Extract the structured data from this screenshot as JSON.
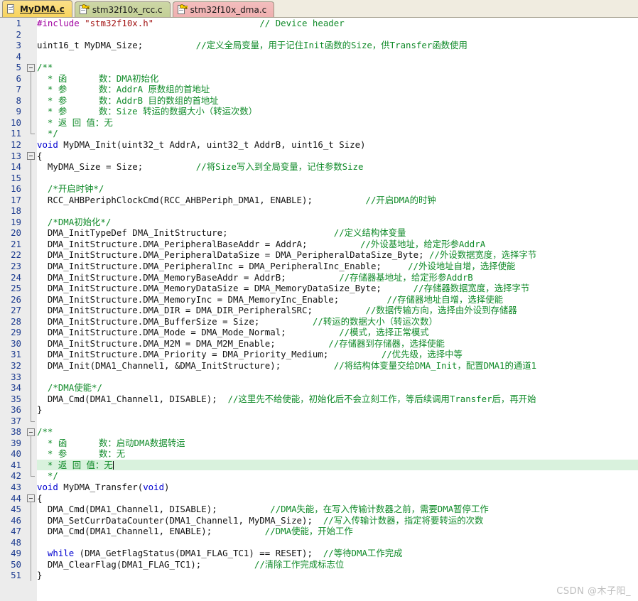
{
  "window": {
    "app": "Keil uVision Editor",
    "watermark": "CSDN @木子阳_"
  },
  "tabs": [
    {
      "label": "MyDMA.c",
      "active": true,
      "icon": "document-icon",
      "locked": false
    },
    {
      "label": "stm32f10x_rcc.c",
      "active": false,
      "icon": "document-key-icon",
      "locked": true
    },
    {
      "label": "stm32f10x_dma.c",
      "active": false,
      "icon": "document-key-icon",
      "locked": true
    }
  ],
  "colors": {
    "keyword": "#0000d0",
    "comment": "#0f8a28",
    "string": "#a31515",
    "preprocessor": "#a000a0",
    "line_number": "#1b3a8f",
    "current_line_highlight": "#d9f2dd",
    "gutter_background": "#ececec",
    "tab_active": "#fada6e",
    "tab_rcc": "#c8d39e",
    "tab_dma": "#f1b6b6"
  },
  "editor": {
    "cursor_line": 41,
    "lines": [
      {
        "n": 1,
        "fold": "none",
        "guide": "none",
        "spans": [
          {
            "t": "#include ",
            "c": "pp"
          },
          {
            "t": "\"stm32f10x.h\"",
            "c": "str"
          },
          {
            "t": "                    ",
            "c": "pl"
          },
          {
            "t": "// Device header",
            "c": "cm"
          }
        ]
      },
      {
        "n": 2,
        "fold": "none",
        "guide": "none",
        "spans": []
      },
      {
        "n": 3,
        "fold": "none",
        "guide": "none",
        "spans": [
          {
            "t": "uint16_t MyDMA_Size;          ",
            "c": "pl"
          },
          {
            "t": "//定义全局变量，用于记住Init函数的Size，供Transfer函数使用",
            "c": "cm"
          }
        ]
      },
      {
        "n": 4,
        "fold": "none",
        "guide": "none",
        "spans": []
      },
      {
        "n": 5,
        "fold": "minus",
        "guide": "start",
        "spans": [
          {
            "t": "/**",
            "c": "cm"
          }
        ]
      },
      {
        "n": 6,
        "fold": "none",
        "guide": "mid",
        "spans": [
          {
            "t": "  * 函      数：DMA初始化",
            "c": "cm"
          }
        ]
      },
      {
        "n": 7,
        "fold": "none",
        "guide": "mid",
        "spans": [
          {
            "t": "  * 参      数：AddrA 原数组的首地址",
            "c": "cm"
          }
        ]
      },
      {
        "n": 8,
        "fold": "none",
        "guide": "mid",
        "spans": [
          {
            "t": "  * 参      数：AddrB 目的数组的首地址",
            "c": "cm"
          }
        ]
      },
      {
        "n": 9,
        "fold": "none",
        "guide": "mid",
        "spans": [
          {
            "t": "  * 参      数：Size 转运的数据大小（转运次数）",
            "c": "cm"
          }
        ]
      },
      {
        "n": 10,
        "fold": "none",
        "guide": "mid",
        "spans": [
          {
            "t": "  * 返 回 值：无",
            "c": "cm"
          }
        ]
      },
      {
        "n": 11,
        "fold": "none",
        "guide": "end",
        "spans": [
          {
            "t": "  */",
            "c": "cm"
          }
        ]
      },
      {
        "n": 12,
        "fold": "none",
        "guide": "none",
        "spans": [
          {
            "t": "void",
            "c": "kw"
          },
          {
            "t": " MyDMA_Init(uint32_t AddrA, uint32_t AddrB, uint16_t Size)",
            "c": "pl"
          }
        ]
      },
      {
        "n": 13,
        "fold": "minus",
        "guide": "start",
        "spans": [
          {
            "t": "{",
            "c": "pl"
          }
        ]
      },
      {
        "n": 14,
        "fold": "none",
        "guide": "mid",
        "spans": [
          {
            "t": "  MyDMA_Size = Size;          ",
            "c": "pl"
          },
          {
            "t": "//将Size写入到全局变量，记住参数Size",
            "c": "cm"
          }
        ]
      },
      {
        "n": 15,
        "fold": "none",
        "guide": "mid",
        "spans": []
      },
      {
        "n": 16,
        "fold": "none",
        "guide": "mid",
        "spans": [
          {
            "t": "  /*开启时钟*/",
            "c": "cm"
          }
        ]
      },
      {
        "n": 17,
        "fold": "none",
        "guide": "mid",
        "spans": [
          {
            "t": "  RCC_AHBPeriphClockCmd(RCC_AHBPeriph_DMA1, ENABLE);          ",
            "c": "pl"
          },
          {
            "t": "//开启DMA的时钟",
            "c": "cm"
          }
        ]
      },
      {
        "n": 18,
        "fold": "none",
        "guide": "mid",
        "spans": []
      },
      {
        "n": 19,
        "fold": "none",
        "guide": "mid",
        "spans": [
          {
            "t": "  /*DMA初始化*/",
            "c": "cm"
          }
        ]
      },
      {
        "n": 20,
        "fold": "none",
        "guide": "mid",
        "spans": [
          {
            "t": "  DMA_InitTypeDef DMA_InitStructure;                    ",
            "c": "pl"
          },
          {
            "t": "//定义结构体变量",
            "c": "cm"
          }
        ]
      },
      {
        "n": 21,
        "fold": "none",
        "guide": "mid",
        "spans": [
          {
            "t": "  DMA_InitStructure.DMA_PeripheralBaseAddr = AddrA;          ",
            "c": "pl"
          },
          {
            "t": "//外设基地址，给定形参AddrA",
            "c": "cm"
          }
        ]
      },
      {
        "n": 22,
        "fold": "none",
        "guide": "mid",
        "spans": [
          {
            "t": "  DMA_InitStructure.DMA_PeripheralDataSize = DMA_PeripheralDataSize_Byte; ",
            "c": "pl"
          },
          {
            "t": "//外设数据宽度，选择字节",
            "c": "cm"
          }
        ]
      },
      {
        "n": 23,
        "fold": "none",
        "guide": "mid",
        "spans": [
          {
            "t": "  DMA_InitStructure.DMA_PeripheralInc = DMA_PeripheralInc_Enable;     ",
            "c": "pl"
          },
          {
            "t": "//外设地址自增，选择使能",
            "c": "cm"
          }
        ]
      },
      {
        "n": 24,
        "fold": "none",
        "guide": "mid",
        "spans": [
          {
            "t": "  DMA_InitStructure.DMA_MemoryBaseAddr = AddrB;          ",
            "c": "pl"
          },
          {
            "t": "//存储器基地址，给定形参AddrB",
            "c": "cm"
          }
        ]
      },
      {
        "n": 25,
        "fold": "none",
        "guide": "mid",
        "spans": [
          {
            "t": "  DMA_InitStructure.DMA_MemoryDataSize = DMA_MemoryDataSize_Byte;      ",
            "c": "pl"
          },
          {
            "t": "//存储器数据宽度，选择字节",
            "c": "cm"
          }
        ]
      },
      {
        "n": 26,
        "fold": "none",
        "guide": "mid",
        "spans": [
          {
            "t": "  DMA_InitStructure.DMA_MemoryInc = DMA_MemoryInc_Enable;         ",
            "c": "pl"
          },
          {
            "t": "//存储器地址自增，选择使能",
            "c": "cm"
          }
        ]
      },
      {
        "n": 27,
        "fold": "none",
        "guide": "mid",
        "spans": [
          {
            "t": "  DMA_InitStructure.DMA_DIR = DMA_DIR_PeripheralSRC;          ",
            "c": "pl"
          },
          {
            "t": "//数据传输方向，选择由外设到存储器",
            "c": "cm"
          }
        ]
      },
      {
        "n": 28,
        "fold": "none",
        "guide": "mid",
        "spans": [
          {
            "t": "  DMA_InitStructure.DMA_BufferSize = Size;          ",
            "c": "pl"
          },
          {
            "t": "//转运的数据大小（转运次数）",
            "c": "cm"
          }
        ]
      },
      {
        "n": 29,
        "fold": "none",
        "guide": "mid",
        "spans": [
          {
            "t": "  DMA_InitStructure.DMA_Mode = DMA_Mode_Normal;          ",
            "c": "pl"
          },
          {
            "t": "//模式，选择正常模式",
            "c": "cm"
          }
        ]
      },
      {
        "n": 30,
        "fold": "none",
        "guide": "mid",
        "spans": [
          {
            "t": "  DMA_InitStructure.DMA_M2M = DMA_M2M_Enable;          ",
            "c": "pl"
          },
          {
            "t": "//存储器到存储器，选择使能",
            "c": "cm"
          }
        ]
      },
      {
        "n": 31,
        "fold": "none",
        "guide": "mid",
        "spans": [
          {
            "t": "  DMA_InitStructure.DMA_Priority = DMA_Priority_Medium;          ",
            "c": "pl"
          },
          {
            "t": "//优先级，选择中等",
            "c": "cm"
          }
        ]
      },
      {
        "n": 32,
        "fold": "none",
        "guide": "mid",
        "spans": [
          {
            "t": "  DMA_Init(DMA1_Channel1, &DMA_InitStructure);          ",
            "c": "pl"
          },
          {
            "t": "//将结构体变量交给DMA_Init，配置DMA1的通道1",
            "c": "cm"
          }
        ]
      },
      {
        "n": 33,
        "fold": "none",
        "guide": "mid",
        "spans": []
      },
      {
        "n": 34,
        "fold": "none",
        "guide": "mid",
        "spans": [
          {
            "t": "  /*DMA使能*/",
            "c": "cm"
          }
        ]
      },
      {
        "n": 35,
        "fold": "none",
        "guide": "mid",
        "spans": [
          {
            "t": "  DMA_Cmd(DMA1_Channel1, DISABLE);  ",
            "c": "pl"
          },
          {
            "t": "//这里先不给使能，初始化后不会立刻工作，等后续调用Transfer后，再开始",
            "c": "cm"
          }
        ]
      },
      {
        "n": 36,
        "fold": "none",
        "guide": "mid",
        "spans": [
          {
            "t": "}",
            "c": "pl"
          }
        ]
      },
      {
        "n": 37,
        "fold": "none",
        "guide": "end",
        "spans": []
      },
      {
        "n": 38,
        "fold": "minus",
        "guide": "start",
        "spans": [
          {
            "t": "/**",
            "c": "cm"
          }
        ]
      },
      {
        "n": 39,
        "fold": "none",
        "guide": "mid",
        "spans": [
          {
            "t": "  * 函      数：启动DMA数据转运",
            "c": "cm"
          }
        ]
      },
      {
        "n": 40,
        "fold": "none",
        "guide": "mid",
        "spans": [
          {
            "t": "  * 参      数：无",
            "c": "cm"
          }
        ]
      },
      {
        "n": 41,
        "fold": "none",
        "guide": "mid",
        "hl": true,
        "cursor": true,
        "spans": [
          {
            "t": "  * 返 回 值：无",
            "c": "cm"
          }
        ]
      },
      {
        "n": 42,
        "fold": "none",
        "guide": "end",
        "spans": [
          {
            "t": "  */",
            "c": "cm"
          }
        ]
      },
      {
        "n": 43,
        "fold": "none",
        "guide": "none",
        "spans": [
          {
            "t": "void",
            "c": "kw"
          },
          {
            "t": " MyDMA_Transfer(",
            "c": "pl"
          },
          {
            "t": "void",
            "c": "kw"
          },
          {
            "t": ")",
            "c": "pl"
          }
        ]
      },
      {
        "n": 44,
        "fold": "minus",
        "guide": "start",
        "spans": [
          {
            "t": "{",
            "c": "pl"
          }
        ]
      },
      {
        "n": 45,
        "fold": "none",
        "guide": "mid",
        "spans": [
          {
            "t": "  DMA_Cmd(DMA1_Channel1, DISABLE);          ",
            "c": "pl"
          },
          {
            "t": "//DMA失能，在写入传输计数器之前，需要DMA暂停工作",
            "c": "cm"
          }
        ]
      },
      {
        "n": 46,
        "fold": "none",
        "guide": "mid",
        "spans": [
          {
            "t": "  DMA_SetCurrDataCounter(DMA1_Channel1, MyDMA_Size);  ",
            "c": "pl"
          },
          {
            "t": "//写入传输计数器，指定将要转运的次数",
            "c": "cm"
          }
        ]
      },
      {
        "n": 47,
        "fold": "none",
        "guide": "mid",
        "spans": [
          {
            "t": "  DMA_Cmd(DMA1_Channel1, ENABLE);          ",
            "c": "pl"
          },
          {
            "t": "//DMA使能，开始工作",
            "c": "cm"
          }
        ]
      },
      {
        "n": 48,
        "fold": "none",
        "guide": "mid",
        "spans": []
      },
      {
        "n": 49,
        "fold": "none",
        "guide": "mid",
        "spans": [
          {
            "t": "  while",
            "c": "kw"
          },
          {
            "t": " (DMA_GetFlagStatus(DMA1_FLAG_TC1) == RESET);  ",
            "c": "pl"
          },
          {
            "t": "//等待DMA工作完成",
            "c": "cm"
          }
        ]
      },
      {
        "n": 50,
        "fold": "none",
        "guide": "mid",
        "spans": [
          {
            "t": "  DMA_ClearFlag(DMA1_FLAG_TC1);          ",
            "c": "pl"
          },
          {
            "t": "//清除工作完成标志位",
            "c": "cm"
          }
        ]
      },
      {
        "n": 51,
        "fold": "none",
        "guide": "mid",
        "spans": [
          {
            "t": "}",
            "c": "pl"
          }
        ]
      }
    ]
  }
}
